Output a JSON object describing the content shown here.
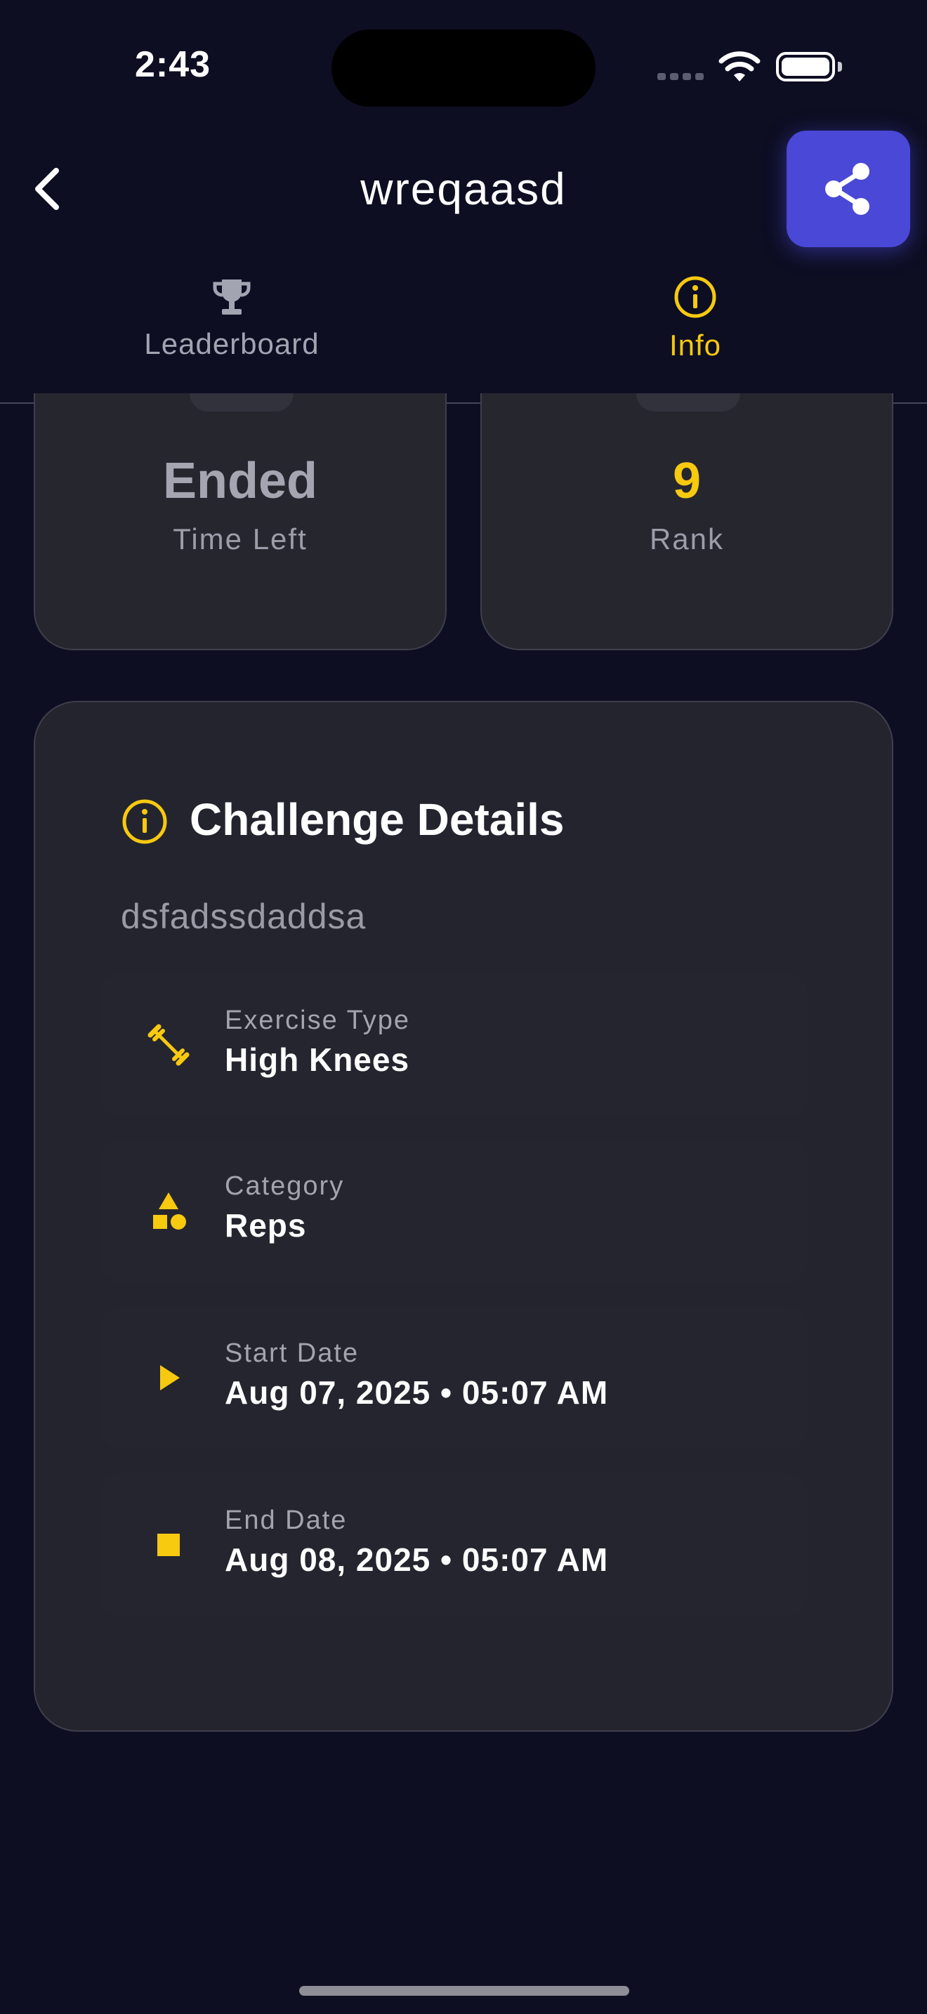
{
  "status_bar": {
    "time": "2:43"
  },
  "header": {
    "title": "wreqaasd",
    "back_icon": "chevron-left-icon",
    "share_icon": "share-icon"
  },
  "tabs": [
    {
      "label": "Leaderboard",
      "icon": "trophy-icon",
      "active": false
    },
    {
      "label": "Info",
      "icon": "info-icon",
      "active": true
    }
  ],
  "stats": {
    "time_left": {
      "value": "Ended",
      "label": "Time Left"
    },
    "rank": {
      "value": "9",
      "label": "Rank"
    }
  },
  "details": {
    "title": "Challenge Details",
    "description": "dsfadssdaddsa",
    "rows": [
      {
        "label": "Exercise Type",
        "value": "High Knees",
        "icon": "dumbbell-icon"
      },
      {
        "label": "Category",
        "value": "Reps",
        "icon": "shapes-icon"
      },
      {
        "label": "Start Date",
        "value": "Aug 07, 2025 • 05:07 AM",
        "icon": "play-icon"
      },
      {
        "label": "End Date",
        "value": "Aug 08, 2025 • 05:07 AM",
        "icon": "stop-icon"
      }
    ]
  },
  "colors": {
    "accent": "#f7c90f",
    "share_button": "#4a48d6",
    "background": "#0d0e22",
    "card": "#24242f"
  }
}
